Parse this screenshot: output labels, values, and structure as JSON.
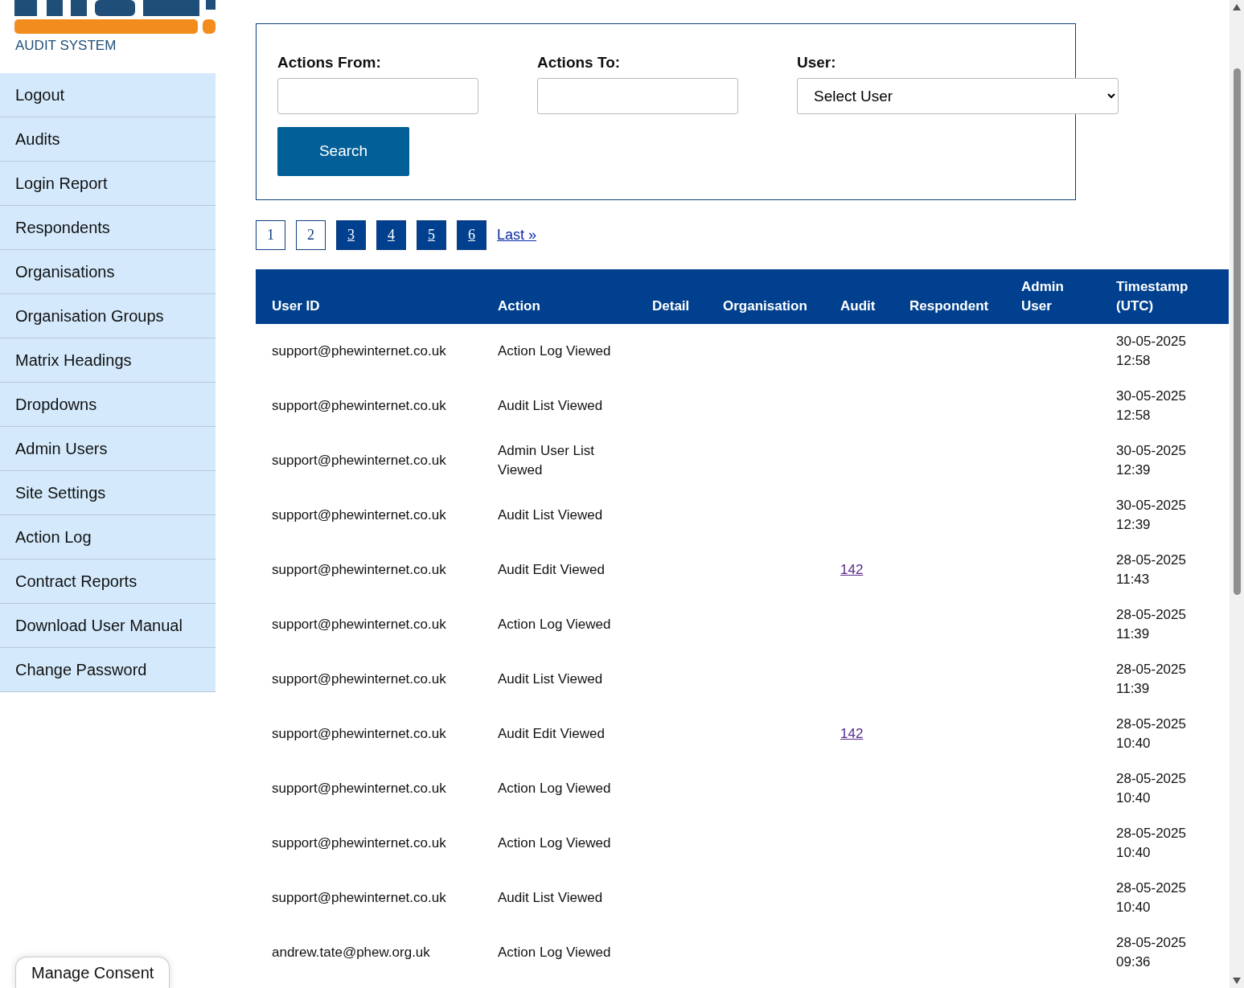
{
  "logo": {
    "subtitle": "AUDIT SYSTEM"
  },
  "sidebar": {
    "items": [
      {
        "label": "Logout"
      },
      {
        "label": "Audits"
      },
      {
        "label": "Login Report"
      },
      {
        "label": "Respondents"
      },
      {
        "label": "Organisations"
      },
      {
        "label": "Organisation Groups"
      },
      {
        "label": "Matrix Headings"
      },
      {
        "label": "Dropdowns"
      },
      {
        "label": "Admin Users"
      },
      {
        "label": "Site Settings"
      },
      {
        "label": "Action Log"
      },
      {
        "label": "Contract Reports"
      },
      {
        "label": "Download User Manual"
      },
      {
        "label": "Change Password"
      }
    ]
  },
  "filters": {
    "from_label": "Actions From:",
    "to_label": "Actions To:",
    "user_label": "User:",
    "user_select": "Select User",
    "search_button": "Search"
  },
  "pagination": {
    "pages": [
      {
        "label": "1",
        "link": false
      },
      {
        "label": "2",
        "link": false
      },
      {
        "label": "3",
        "link": true
      },
      {
        "label": "4",
        "link": true
      },
      {
        "label": "5",
        "link": true
      },
      {
        "label": "6",
        "link": true
      }
    ],
    "last": "Last »"
  },
  "table": {
    "columns": [
      "User ID",
      "Action",
      "Detail",
      "Organisation",
      "Audit",
      "Respondent",
      "Admin User",
      "Timestamp (UTC)"
    ],
    "rows": [
      {
        "user": "support@phewinternet.co.uk",
        "action": "Action Log Viewed",
        "timestamp": "30-05-2025 12:58"
      },
      {
        "user": "support@phewinternet.co.uk",
        "action": "Audit List Viewed",
        "timestamp": "30-05-2025 12:58"
      },
      {
        "user": "support@phewinternet.co.uk",
        "action": "Admin User List Viewed",
        "timestamp": "30-05-2025 12:39"
      },
      {
        "user": "support@phewinternet.co.uk",
        "action": "Audit List Viewed",
        "timestamp": "30-05-2025 12:39"
      },
      {
        "user": "support@phewinternet.co.uk",
        "action": "Audit Edit Viewed",
        "audit": "142",
        "timestamp": "28-05-2025 11:43"
      },
      {
        "user": "support@phewinternet.co.uk",
        "action": "Action Log Viewed",
        "timestamp": "28-05-2025 11:39"
      },
      {
        "user": "support@phewinternet.co.uk",
        "action": "Audit List Viewed",
        "timestamp": "28-05-2025 11:39"
      },
      {
        "user": "support@phewinternet.co.uk",
        "action": "Audit Edit Viewed",
        "audit": "142",
        "timestamp": "28-05-2025 10:40"
      },
      {
        "user": "support@phewinternet.co.uk",
        "action": "Action Log Viewed",
        "timestamp": "28-05-2025 10:40"
      },
      {
        "user": "support@phewinternet.co.uk",
        "action": "Action Log Viewed",
        "timestamp": "28-05-2025 10:40"
      },
      {
        "user": "support@phewinternet.co.uk",
        "action": "Audit List Viewed",
        "timestamp": "28-05-2025 10:40"
      },
      {
        "user": "andrew.tate@phew.org.uk",
        "action": "Action Log Viewed",
        "timestamp": "28-05-2025 09:36"
      }
    ]
  },
  "consent_button": "Manage Consent"
}
